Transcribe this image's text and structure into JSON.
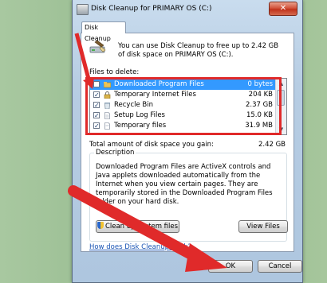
{
  "window": {
    "title": "Disk Cleanup for PRIMARY OS (C:)",
    "close_glyph": "✕"
  },
  "tab": {
    "label": "Disk Cleanup"
  },
  "intro": {
    "text": "You can use Disk Cleanup to free up to 2.42 GB of disk space on PRIMARY OS (C:)."
  },
  "files": {
    "label": "Files to delete:",
    "items": [
      {
        "name": "Downloaded Program Files",
        "size": "0 bytes",
        "checked": false,
        "selected": true
      },
      {
        "name": "Temporary Internet Files",
        "size": "204 KB",
        "checked": true,
        "selected": false
      },
      {
        "name": "Recycle Bin",
        "size": "2.37 GB",
        "checked": true,
        "selected": false
      },
      {
        "name": "Setup Log Files",
        "size": "15.0 KB",
        "checked": true,
        "selected": false
      },
      {
        "name": "Temporary files",
        "size": "31.9 MB",
        "checked": true,
        "selected": false
      }
    ]
  },
  "total": {
    "label": "Total amount of disk space you gain:",
    "value": "2.42 GB"
  },
  "description": {
    "legend": "Description",
    "text": "Downloaded Program Files are ActiveX controls and Java applets downloaded automatically from the Internet when you view certain pages. They are temporarily stored in the Downloaded Program Files folder on your hard disk."
  },
  "buttons": {
    "clean_up": "Clean up system files",
    "view_files": "View Files",
    "ok": "OK",
    "cancel": "Cancel"
  },
  "link": {
    "text": "How does Disk Cleanup work?"
  },
  "colors": {
    "highlight_red": "#e02a2a",
    "selection_blue": "#3399ff"
  }
}
